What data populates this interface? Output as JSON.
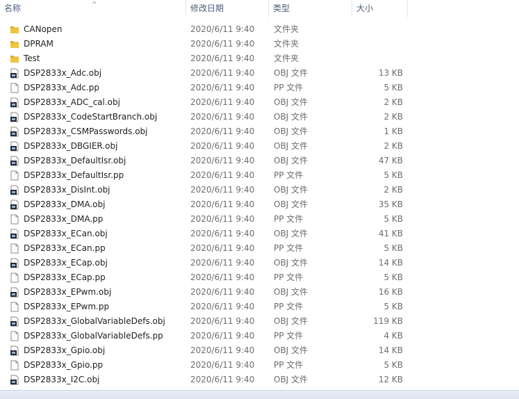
{
  "columns": {
    "name": "名称",
    "date": "修改日期",
    "type": "类型",
    "size": "大小"
  },
  "sort_indicator": "^",
  "files": [
    {
      "icon": "folder-icon",
      "name": "CANopen",
      "date": "2020/6/11 9:40",
      "type": "文件夹",
      "size": ""
    },
    {
      "icon": "folder-icon",
      "name": "DPRAM",
      "date": "2020/6/11 9:40",
      "type": "文件夹",
      "size": ""
    },
    {
      "icon": "folder-icon",
      "name": "Test",
      "date": "2020/6/11 9:40",
      "type": "文件夹",
      "size": ""
    },
    {
      "icon": "obj-file-icon",
      "name": "DSP2833x_Adc.obj",
      "date": "2020/6/11 9:40",
      "type": "OBJ 文件",
      "size": "13 KB"
    },
    {
      "icon": "blank-file-icon",
      "name": "DSP2833x_Adc.pp",
      "date": "2020/6/11 9:40",
      "type": "PP 文件",
      "size": "5 KB"
    },
    {
      "icon": "obj-file-icon",
      "name": "DSP2833x_ADC_cal.obj",
      "date": "2020/6/11 9:40",
      "type": "OBJ 文件",
      "size": "2 KB"
    },
    {
      "icon": "obj-file-icon",
      "name": "DSP2833x_CodeStartBranch.obj",
      "date": "2020/6/11 9:40",
      "type": "OBJ 文件",
      "size": "2 KB"
    },
    {
      "icon": "obj-file-icon",
      "name": "DSP2833x_CSMPasswords.obj",
      "date": "2020/6/11 9:40",
      "type": "OBJ 文件",
      "size": "1 KB"
    },
    {
      "icon": "obj-file-icon",
      "name": "DSP2833x_DBGIER.obj",
      "date": "2020/6/11 9:40",
      "type": "OBJ 文件",
      "size": "2 KB"
    },
    {
      "icon": "obj-file-icon",
      "name": "DSP2833x_DefaultIsr.obj",
      "date": "2020/6/11 9:40",
      "type": "OBJ 文件",
      "size": "47 KB"
    },
    {
      "icon": "blank-file-icon",
      "name": "DSP2833x_DefaultIsr.pp",
      "date": "2020/6/11 9:40",
      "type": "PP 文件",
      "size": "5 KB"
    },
    {
      "icon": "obj-file-icon",
      "name": "DSP2833x_DisInt.obj",
      "date": "2020/6/11 9:40",
      "type": "OBJ 文件",
      "size": "2 KB"
    },
    {
      "icon": "obj-file-icon",
      "name": "DSP2833x_DMA.obj",
      "date": "2020/6/11 9:40",
      "type": "OBJ 文件",
      "size": "35 KB"
    },
    {
      "icon": "blank-file-icon",
      "name": "DSP2833x_DMA.pp",
      "date": "2020/6/11 9:40",
      "type": "PP 文件",
      "size": "5 KB"
    },
    {
      "icon": "obj-file-icon",
      "name": "DSP2833x_ECan.obj",
      "date": "2020/6/11 9:40",
      "type": "OBJ 文件",
      "size": "41 KB"
    },
    {
      "icon": "blank-file-icon",
      "name": "DSP2833x_ECan.pp",
      "date": "2020/6/11 9:40",
      "type": "PP 文件",
      "size": "5 KB"
    },
    {
      "icon": "obj-file-icon",
      "name": "DSP2833x_ECap.obj",
      "date": "2020/6/11 9:40",
      "type": "OBJ 文件",
      "size": "14 KB"
    },
    {
      "icon": "blank-file-icon",
      "name": "DSP2833x_ECap.pp",
      "date": "2020/6/11 9:40",
      "type": "PP 文件",
      "size": "5 KB"
    },
    {
      "icon": "obj-file-icon",
      "name": "DSP2833x_EPwm.obj",
      "date": "2020/6/11 9:40",
      "type": "OBJ 文件",
      "size": "16 KB"
    },
    {
      "icon": "blank-file-icon",
      "name": "DSP2833x_EPwm.pp",
      "date": "2020/6/11 9:40",
      "type": "PP 文件",
      "size": "5 KB"
    },
    {
      "icon": "obj-file-icon",
      "name": "DSP2833x_GlobalVariableDefs.obj",
      "date": "2020/6/11 9:40",
      "type": "OBJ 文件",
      "size": "119 KB"
    },
    {
      "icon": "blank-file-icon",
      "name": "DSP2833x_GlobalVariableDefs.pp",
      "date": "2020/6/11 9:40",
      "type": "PP 文件",
      "size": "4 KB"
    },
    {
      "icon": "obj-file-icon",
      "name": "DSP2833x_Gpio.obj",
      "date": "2020/6/11 9:40",
      "type": "OBJ 文件",
      "size": "14 KB"
    },
    {
      "icon": "blank-file-icon",
      "name": "DSP2833x_Gpio.pp",
      "date": "2020/6/11 9:40",
      "type": "PP 文件",
      "size": "5 KB"
    },
    {
      "icon": "obj-file-icon",
      "name": "DSP2833x_I2C.obj",
      "date": "2020/6/11 9:40",
      "type": "OBJ 文件",
      "size": "12 KB"
    }
  ],
  "colors": {
    "folder": "#f0c441",
    "folder_dark": "#d9a520",
    "header_text": "#4c607a",
    "name_text": "#1e1e1e",
    "meta_text": "#6d6d6d"
  }
}
